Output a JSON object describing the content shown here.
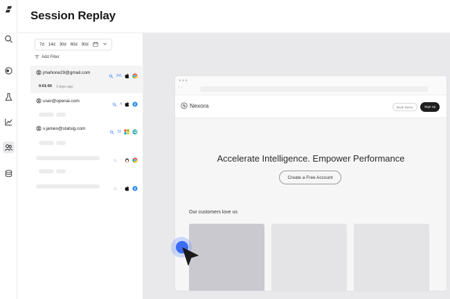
{
  "header": {
    "title": "Session Replay"
  },
  "rail": [
    "logo-icon",
    "search-icon",
    "toggle-icon",
    "flask-icon",
    "chart-icon",
    "users-icon",
    "database-icon"
  ],
  "filters": {
    "date_options": [
      "7d",
      "14d",
      "30d",
      "60d",
      "90d"
    ],
    "add_filter_label": "Add Filter"
  },
  "sessions": [
    {
      "user": "jmahone29@gmail.com",
      "count": "241",
      "duration": "0:01:50",
      "ago": "3 days ago",
      "os": "apple-icon",
      "browser": "chrome-icon"
    },
    {
      "user": "user@openai.com",
      "count": "4",
      "os": "apple-icon",
      "browser": "safari-icon"
    },
    {
      "user": "v.james@statsig.com",
      "count": "32",
      "os": "windows-icon",
      "browser": "edge-icon"
    }
  ],
  "replay": {
    "brand": "Nexora",
    "book_demo": "Book Demo",
    "sign_up": "Sign up",
    "hero": "Accelerate Intelligence. Empower Performance",
    "cta": "Create a Free Account",
    "customers": "Our customers love us"
  }
}
